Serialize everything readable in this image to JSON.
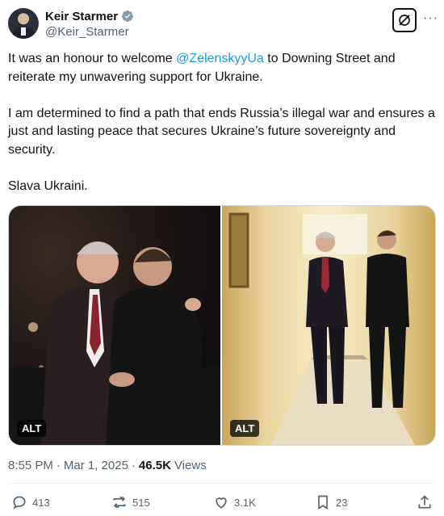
{
  "author": {
    "display_name": "Keir Starmer",
    "handle": "@Keir_Starmer",
    "verified": true
  },
  "header": {
    "more_label": "···"
  },
  "tweet": {
    "line1_before": "It was an honour to welcome ",
    "mention": "@ZelenskyyUa",
    "line1_after": " to Downing Street and reiterate my unwavering support for Ukraine.",
    "paragraph2": "I am determined to find a path that ends Russia’s illegal war and ensures a just and lasting peace that secures Ukraine’s future sovereignty and security.",
    "paragraph3": "Slava Ukraini."
  },
  "media": {
    "left_alt": "ALT",
    "right_alt": "ALT"
  },
  "meta": {
    "time": "8:55 PM",
    "separator": "·",
    "date": "Mar 1, 2025",
    "views_count": "46.5K",
    "views_label": "Views"
  },
  "actions": {
    "replies": "413",
    "reposts": "515",
    "likes": "3.1K",
    "bookmarks": "23"
  },
  "colors": {
    "accent": "#1d9bf0",
    "text_primary": "#0f1419",
    "text_secondary": "#536471",
    "border": "#cfd9de"
  }
}
